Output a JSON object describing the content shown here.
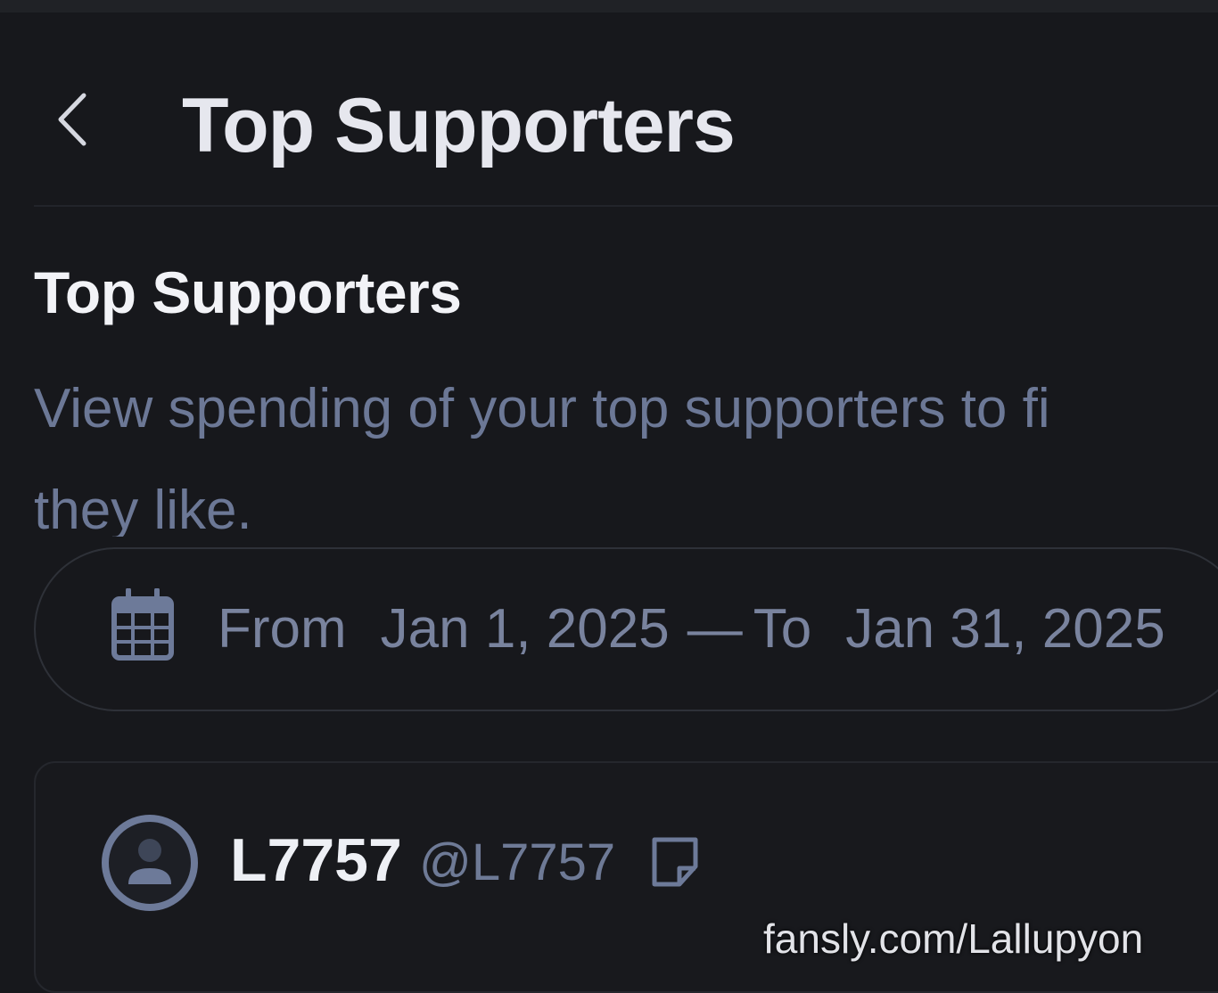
{
  "header": {
    "title": "Top Supporters",
    "back_icon": "chevron-left-icon"
  },
  "section": {
    "title": "Top Supporters",
    "description_line1": "View spending of your top supporters to fi",
    "description_line2": "they like."
  },
  "date_range": {
    "icon": "calendar-icon",
    "from_label": "From",
    "from_date": "Jan 1, 2025",
    "separator": "—",
    "to_label": "To",
    "to_date": "Jan 31, 2025"
  },
  "supporters": [
    {
      "display_name": "L7757",
      "username": "@L7757",
      "avatar_icon": "user-avatar-icon",
      "note_icon": "note-icon"
    }
  ],
  "watermark": "fansly.com/Lallupyon",
  "colors": {
    "background": "#17181c",
    "title_text": "#e6e7ee",
    "muted_text": "#6c7896",
    "border": "#2e3138"
  }
}
